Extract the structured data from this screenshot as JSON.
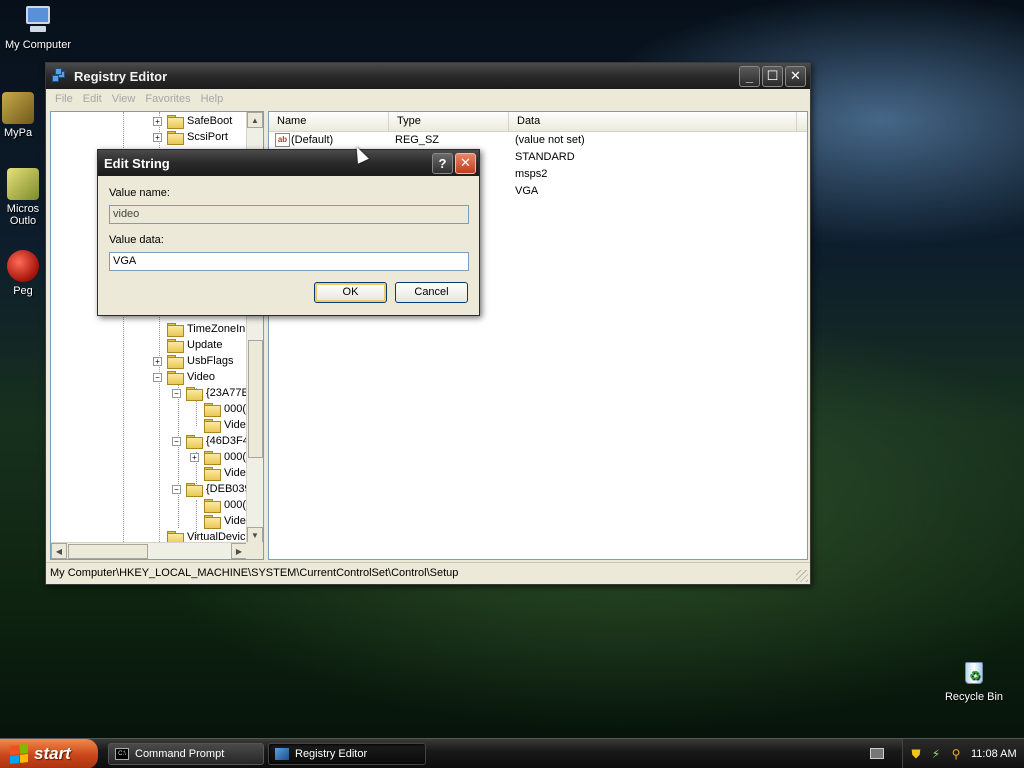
{
  "desktop": {
    "icons": [
      {
        "label": "My Computer"
      },
      {
        "label": "MyPa"
      },
      {
        "label": "Micros Outlo"
      },
      {
        "label": "Peg"
      },
      {
        "label": "Recycle Bin"
      }
    ]
  },
  "window": {
    "title": "Registry Editor",
    "menu": [
      "File",
      "Edit",
      "View",
      "Favorites",
      "Help"
    ],
    "tree": [
      {
        "label": "SafeBoot",
        "expander": "+"
      },
      {
        "label": "ScsiPort",
        "expander": "+"
      },
      {
        "label": "TimeZoneInl",
        "expander": ""
      },
      {
        "label": "Update",
        "expander": ""
      },
      {
        "label": "UsbFlags",
        "expander": "+"
      },
      {
        "label": "Video",
        "expander": "−"
      },
      {
        "label": "{23A77E",
        "expander": "−"
      },
      {
        "label": "000(",
        "expander": ""
      },
      {
        "label": "Vide",
        "expander": ""
      },
      {
        "label": "{46D3F4",
        "expander": "−"
      },
      {
        "label": "000(",
        "expander": "+"
      },
      {
        "label": "Vide",
        "expander": ""
      },
      {
        "label": "{DEB039",
        "expander": "−"
      },
      {
        "label": "000(",
        "expander": ""
      },
      {
        "label": "Vide",
        "expander": ""
      },
      {
        "label": "VirtualDevic",
        "expander": ""
      }
    ],
    "list": {
      "columns": [
        "Name",
        "Type",
        "Data"
      ],
      "rows": [
        {
          "name": "(Default)",
          "type": "REG_SZ",
          "data": "(value not set)"
        },
        {
          "name": "",
          "type": "",
          "data": "STANDARD"
        },
        {
          "name": "",
          "type": "",
          "data": "msps2"
        },
        {
          "name": "",
          "type": "",
          "data": "VGA"
        }
      ]
    },
    "status": "My Computer\\HKEY_LOCAL_MACHINE\\SYSTEM\\CurrentControlSet\\Control\\Setup"
  },
  "dialog": {
    "title": "Edit String",
    "value_name_label": "Value name:",
    "value_name": "video",
    "value_data_label": "Value data:",
    "value_data": "VGA",
    "ok_label": "OK",
    "cancel_label": "Cancel"
  },
  "taskbar": {
    "start_label": "start",
    "tasks": [
      {
        "label": "Command Prompt"
      },
      {
        "label": "Registry Editor"
      }
    ],
    "clock": "11:08 AM"
  },
  "colors": {
    "start_orange": "#c9461a",
    "title_dark": "#2a2a2a",
    "close_red": "#c23c1c"
  }
}
